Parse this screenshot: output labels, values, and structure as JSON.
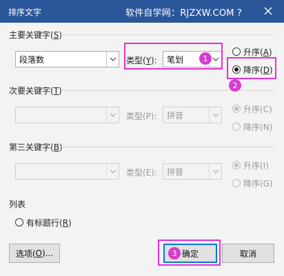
{
  "window": {
    "title": "排序文字",
    "help_text": "软件自学网：RJZXW.COM ?",
    "close_symbol": "✕"
  },
  "primary": {
    "label_prefix": "主要关键字(",
    "label_key": "S",
    "label_suffix": ")",
    "field_value": "段落数",
    "type_label_prefix": "类型(",
    "type_label_key": "Y",
    "type_label_suffix": "):",
    "type_value": "笔划",
    "asc_prefix": "升序(",
    "asc_key": "A",
    "asc_suffix": ")",
    "desc_prefix": "降序(",
    "desc_key": "D",
    "desc_suffix": ")",
    "order": "descending"
  },
  "secondary": {
    "label_prefix": "次要关键字(",
    "label_key": "T",
    "label_suffix": ")",
    "field_value": "",
    "type_label": "类型(P):",
    "type_value": "拼音",
    "asc_label": "升序(C)",
    "desc_label": "降序(N)",
    "order": "ascending"
  },
  "tertiary": {
    "label_prefix": "第三关键字(",
    "label_key": "B",
    "label_suffix": ")",
    "field_value": "",
    "type_label": "类型(E):",
    "type_value": "拼音",
    "asc_label": "升序(I)",
    "desc_label": "降序(G)",
    "order": "ascending"
  },
  "list": {
    "label": "列表",
    "header_row_prefix": "有标题行(",
    "header_row_key": "R",
    "header_row_suffix": ")"
  },
  "buttons": {
    "options_prefix": "选项(",
    "options_key": "O",
    "options_suffix": ")...",
    "ok": "确定",
    "cancel": "取消"
  },
  "annotations": {
    "badge_1": "1",
    "badge_2": "2",
    "badge_3": "3",
    "highlight_color": "#e52fd1",
    "badge_color": "#d63ccd"
  },
  "colors": {
    "titlebar": "#2b579a",
    "dialog_bg": "#f3f3f3",
    "default_button_border": "#0078d7"
  }
}
